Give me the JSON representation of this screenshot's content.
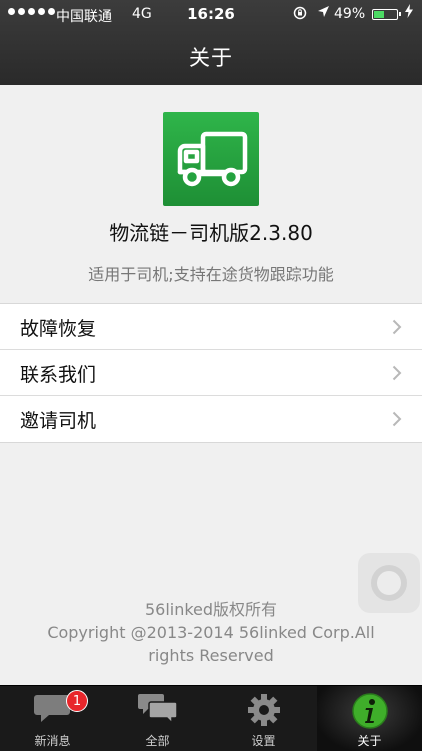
{
  "status_bar": {
    "carrier": "中国联通",
    "network": "4G",
    "time": "16:26",
    "battery_percent": "49%",
    "battery_level": 0.49,
    "icons": [
      "signal-dots-icon",
      "orientation-lock-icon",
      "location-arrow-icon",
      "battery-icon",
      "charging-bolt-icon"
    ]
  },
  "nav": {
    "title": "关于"
  },
  "app": {
    "icon": "truck-icon",
    "name": "物流链－司机版2.3.80",
    "description": "适用于司机;支持在途货物跟踪功能"
  },
  "menu": {
    "items": [
      {
        "label": "故障恢复",
        "icon": "chevron-right-icon"
      },
      {
        "label": "联系我们",
        "icon": "chevron-right-icon"
      },
      {
        "label": "邀请司机",
        "icon": "chevron-right-icon"
      }
    ]
  },
  "footer": {
    "line1": "56linked版权所有",
    "line2": "Copyright @2013-2014 56linked Corp.All",
    "line3": "rights Reserved"
  },
  "tabbar": {
    "tabs": [
      {
        "label": "新消息",
        "icon": "chat-bubble-icon",
        "badge": "1"
      },
      {
        "label": "全部",
        "icon": "double-chat-icon"
      },
      {
        "label": "设置",
        "icon": "gear-icon"
      },
      {
        "label": "关于",
        "icon": "info-icon",
        "active": true
      }
    ]
  },
  "colors": {
    "accent_green": "#2fb54a",
    "badge_red": "#e8262b",
    "nav_bg": "#333333"
  }
}
